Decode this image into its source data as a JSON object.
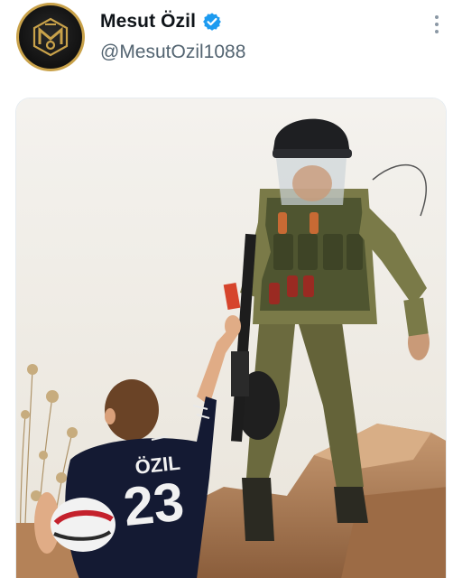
{
  "tweet": {
    "author": {
      "display_name": "Mesut Özil",
      "handle": "@MesutOzil1088",
      "verified": true,
      "avatar_icon": "m10-logo-icon"
    },
    "more_icon": "more-options-icon",
    "media": {
      "jersey_name": "ÖZIL",
      "jersey_number": "23"
    }
  },
  "colors": {
    "verified_blue": "#1d9bf0",
    "handle_gray": "#536471",
    "avatar_gold": "#c9a24a"
  }
}
